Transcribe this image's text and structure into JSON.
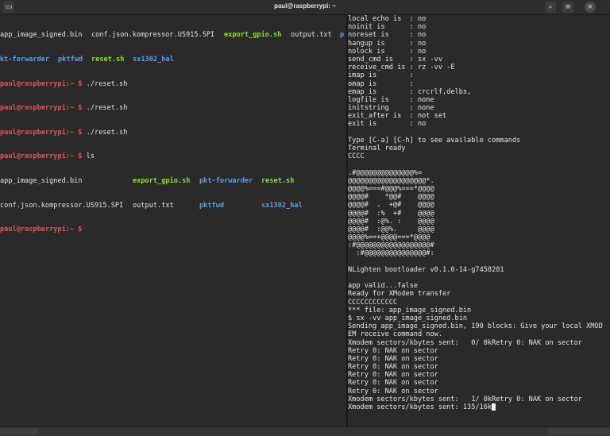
{
  "window": {
    "title": "paul@raspberrypi: ~",
    "menu_icon": "terminal-icon",
    "search_icon": "search-icon",
    "hamburger_icon": "hamburger-menu-icon",
    "close_icon": "close-icon"
  },
  "colors": {
    "background": "#2a2a2a",
    "text": "#e4e4e4",
    "exec": "#8ae234",
    "dir": "#5c9ee6",
    "prompt": "#e55353"
  },
  "left": {
    "row0": [
      "app_image_signed.bin",
      "conf.json.kompressor.US915.SPI",
      "export_gpio.sh",
      "output.txt",
      "p"
    ],
    "row1": [
      "kt-forwarder",
      "pktfwd",
      "reset.sh",
      "sx1302_hal"
    ],
    "prompt_text": "paul@raspberrypi:~ $",
    "cmd1": "./reset.sh",
    "cmd2": "./reset.sh",
    "cmd3": "./reset.sh",
    "cmd4": "ls",
    "ls_row1": [
      "app_image_signed.bin",
      "export_gpio.sh",
      "pkt-forwarder",
      "reset.sh"
    ],
    "ls_row2": [
      "conf.json.kompressor.US915.SPI",
      "output.txt",
      "pktfwd",
      "sx1302_hal"
    ]
  },
  "right": {
    "lines": [
      "local echo is  : no",
      "noinit is      : no",
      "noreset is     : no",
      "hangup is      : no",
      "nolock is      : no",
      "send_cmd is    : sx -vv",
      "receive_cmd is : rz -vv -E",
      "imap is        :",
      "omap is        :",
      "emap is        : crcrlf,delbs,",
      "logfile is     : none",
      "initstring     : none",
      "exit_after is  : not set",
      "exit is        : no",
      "",
      "Type [C-a] [C-h] to see available commands",
      "Terminal ready",
      "CCCC",
      "",
      ".#@@@@@@@@@@@@@@%=",
      "@@@@@@@@@@@@@@@@@@@*.",
      "@@@@%===#@@@%===*@@@@",
      "@@@@#    *@@#    @@@@",
      "@@@@#  .  +@#    @@@@",
      "@@@@#  :%  +#    @@@@",
      "@@@@#  :@%. :    @@@@",
      "@@@@#  :@@%.     @@@@",
      "@@@@%==+@@@@===*@@@@",
      ":#@@@@@@@@@@@@@@@@@@#",
      "  :#@@@@@@@@@@@@@@@#:",
      "",
      "NLighten bootloader v0.1.0-14-g7458281",
      "",
      "app valid...false",
      "Ready for XModem transfer",
      "CCCCCCCCCCCC",
      "*** file: app_image_signed.bin",
      "$ sx -vv app_image_signed.bin",
      "Sending app_image_signed.bin, 190 blocks: Give your local XMOD",
      "EM receive command now.",
      "Xmodem sectors/kbytes sent:   0/ 0kRetry 0: NAK on sector",
      "Retry 0: NAK on sector",
      "Retry 0: NAK on sector",
      "Retry 0: NAK on sector",
      "Retry 0: NAK on sector",
      "Retry 0: NAK on sector",
      "Retry 0: NAK on sector",
      "Xmodem sectors/kbytes sent:   1/ 0kRetry 0: NAK on sector"
    ],
    "last_line": "Xmodem sectors/kbytes sent: 135/16k"
  }
}
